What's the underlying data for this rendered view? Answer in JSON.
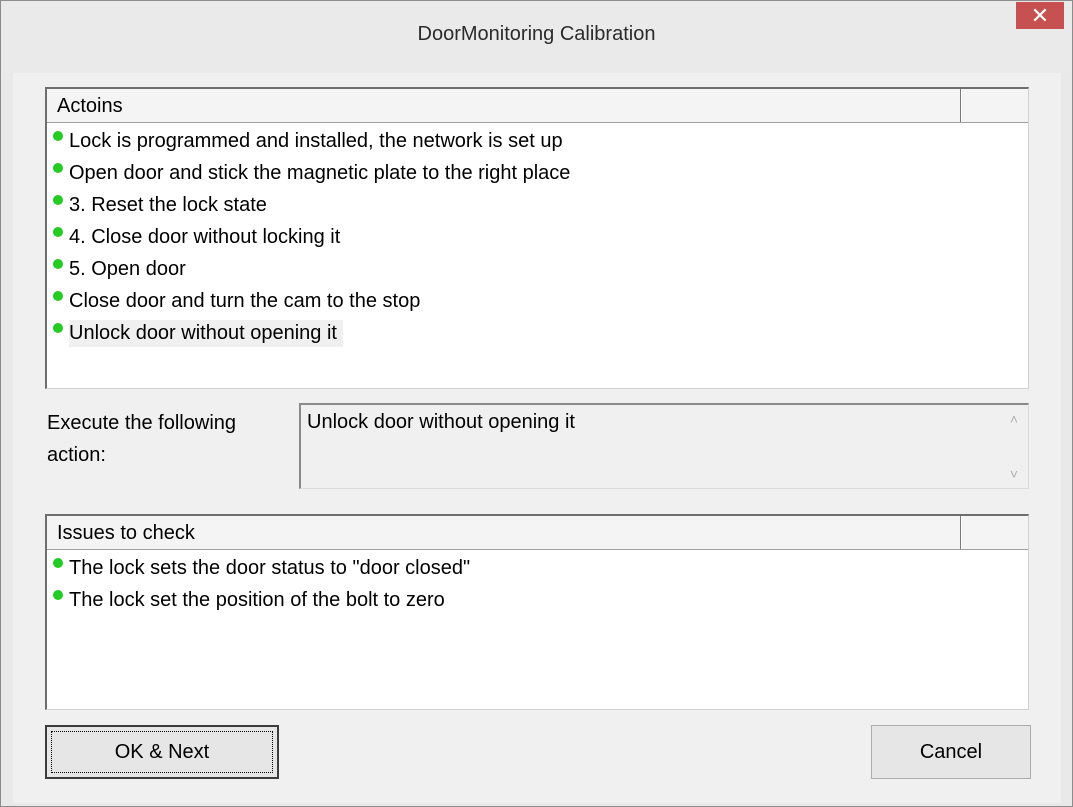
{
  "window": {
    "title": "DoorMonitoring Calibration",
    "close_glyph": "✕"
  },
  "actions": {
    "header": "Actoins",
    "items": [
      "Lock is programmed and installed, the network is set up",
      "Open door and stick the magnetic plate to the right place",
      "3. Reset the lock state",
      "4. Close door without locking it",
      "5. Open door",
      "Close door and turn the cam to the stop",
      "Unlock door without opening it"
    ],
    "selected_index": 6
  },
  "execute": {
    "label": "Execute the following action:",
    "value": "Unlock door without opening it",
    "scroll_up_glyph": "˄",
    "scroll_down_glyph": "˅"
  },
  "issues": {
    "header": "Issues to check",
    "items": [
      "The lock sets the door status to \"door closed\"",
      "The lock set the position of the bolt to zero"
    ]
  },
  "buttons": {
    "ok_label": "OK & Next",
    "cancel_label": "Cancel"
  },
  "colors": {
    "status_dot": "#22cc22",
    "close_button": "#c75050"
  }
}
